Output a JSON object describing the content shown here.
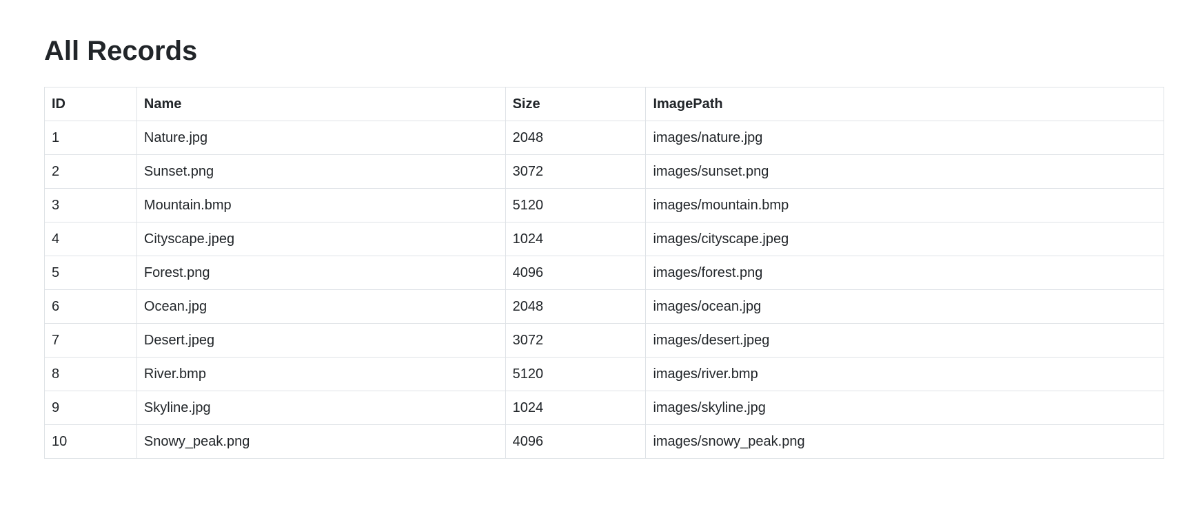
{
  "page": {
    "title": "All Records"
  },
  "table": {
    "headers": [
      "ID",
      "Name",
      "Size",
      "ImagePath"
    ],
    "rows": [
      [
        "1",
        "Nature.jpg",
        "2048",
        "images/nature.jpg"
      ],
      [
        "2",
        "Sunset.png",
        "3072",
        "images/sunset.png"
      ],
      [
        "3",
        "Mountain.bmp",
        "5120",
        "images/mountain.bmp"
      ],
      [
        "4",
        "Cityscape.jpeg",
        "1024",
        "images/cityscape.jpeg"
      ],
      [
        "5",
        "Forest.png",
        "4096",
        "images/forest.png"
      ],
      [
        "6",
        "Ocean.jpg",
        "2048",
        "images/ocean.jpg"
      ],
      [
        "7",
        "Desert.jpeg",
        "3072",
        "images/desert.jpeg"
      ],
      [
        "8",
        "River.bmp",
        "5120",
        "images/river.bmp"
      ],
      [
        "9",
        "Skyline.jpg",
        "1024",
        "images/skyline.jpg"
      ],
      [
        "10",
        "Snowy_peak.png",
        "4096",
        "images/snowy_peak.png"
      ]
    ]
  }
}
